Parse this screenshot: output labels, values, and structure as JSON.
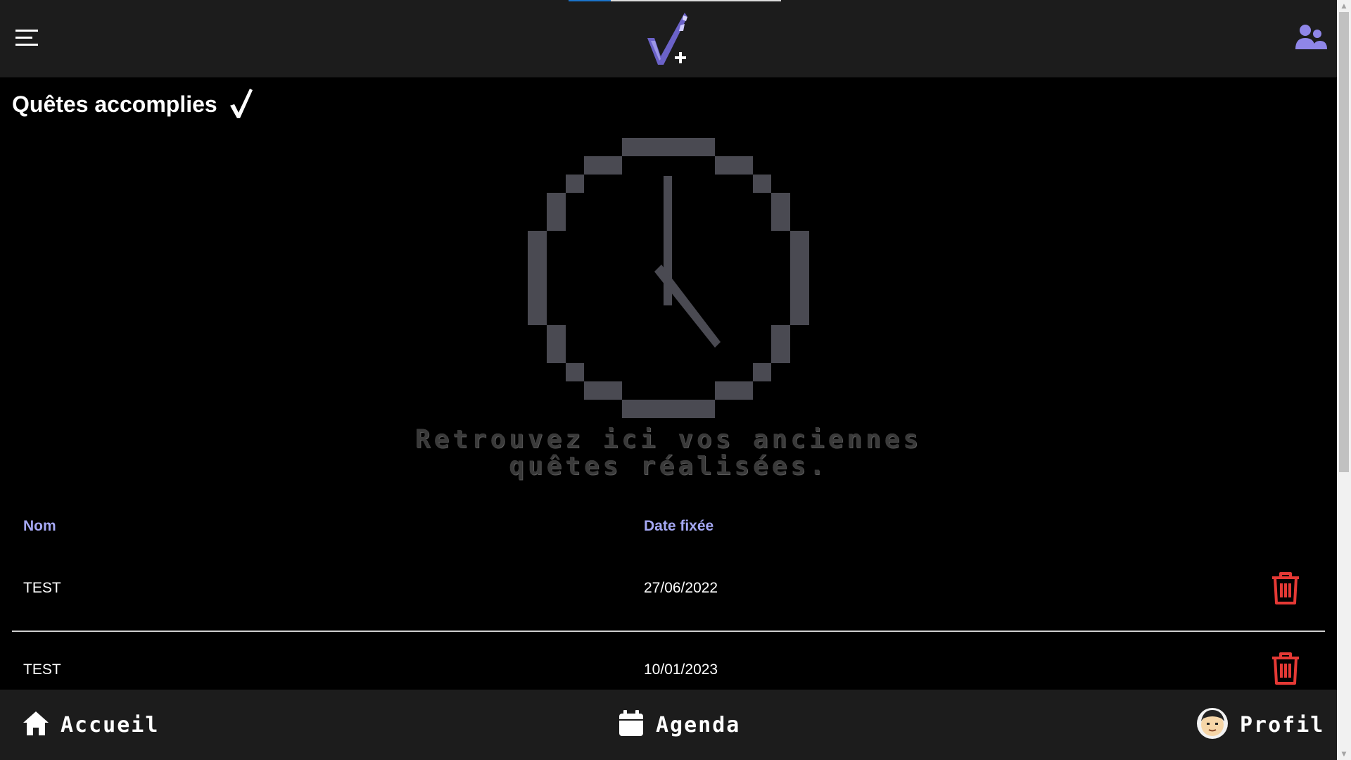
{
  "header": {
    "menu_icon": "hamburger-menu-icon",
    "logo_icon": "checkmark-plus-logo",
    "friends_icon": "friends-icon",
    "loading_progress": 0.2
  },
  "page": {
    "title": "Quêtes accomplies",
    "title_icon": "checkmark-icon"
  },
  "empty_state": {
    "icon": "pixel-clock-icon",
    "line1": "Retrouvez ici vos anciennes",
    "line2": "quêtes réalisées."
  },
  "table": {
    "columns": [
      "Nom",
      "Date fixée"
    ],
    "rows": [
      {
        "name": "TEST",
        "date": "27/06/2022"
      },
      {
        "name": "TEST",
        "date": "10/01/2023"
      }
    ],
    "delete_icon": "trash-icon"
  },
  "bottom_nav": {
    "items": [
      {
        "label": "Accueil",
        "icon": "home-icon"
      },
      {
        "label": "Agenda",
        "icon": "calendar-icon"
      },
      {
        "label": "Profil",
        "icon": "avatar-icon"
      }
    ]
  },
  "colors": {
    "accent": "#a5a8f4",
    "logo_purple": "#6b62c8",
    "danger": "#e53935",
    "bar_background": "#1c1c1c",
    "clock_gray": "#4a4a52"
  }
}
